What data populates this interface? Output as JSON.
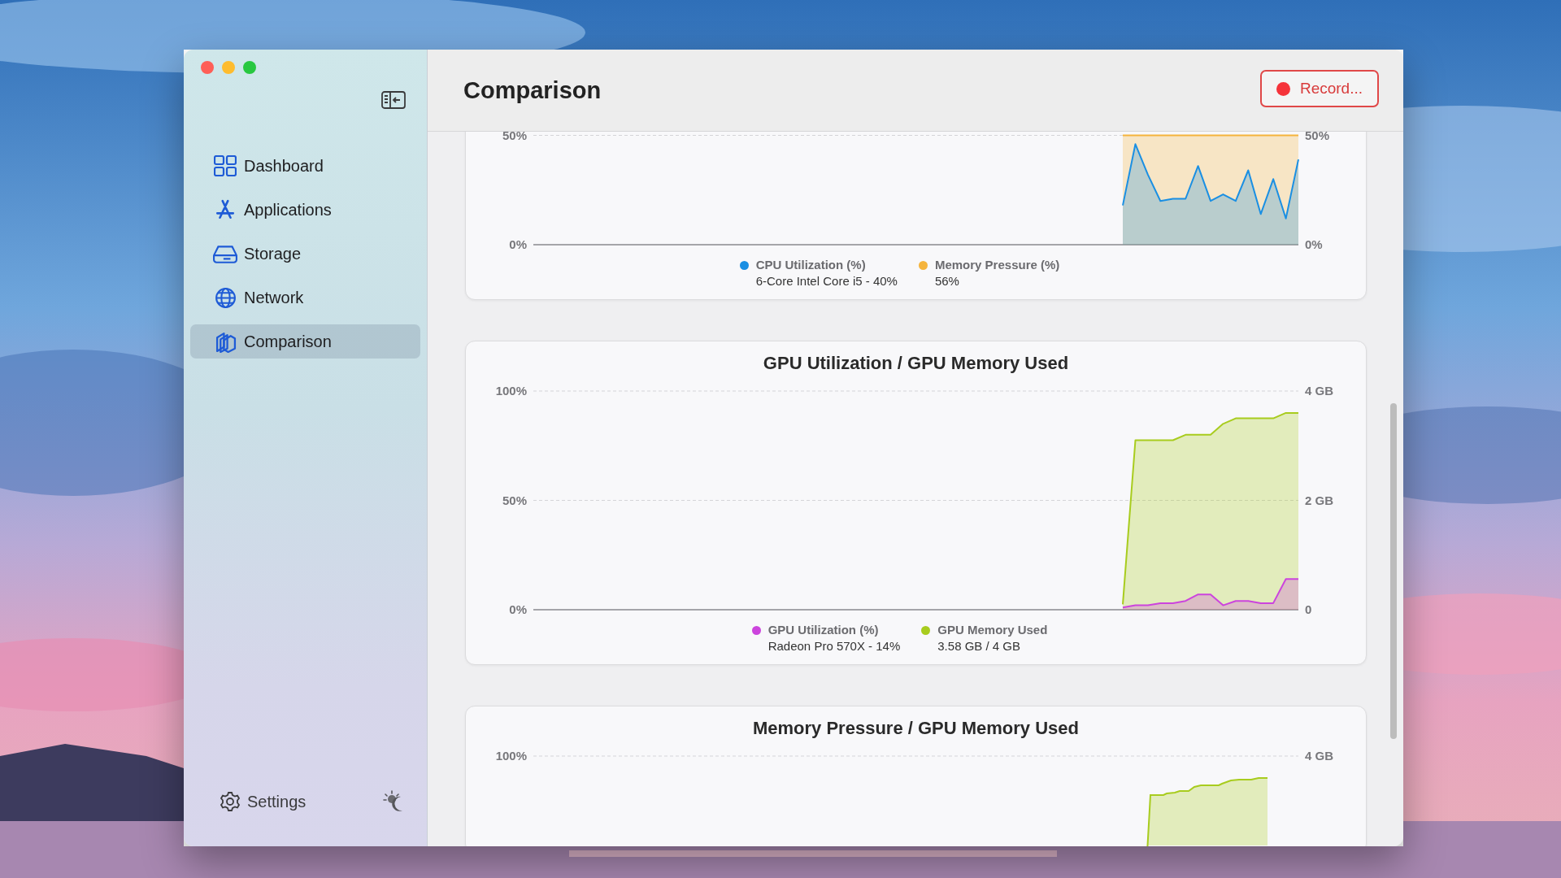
{
  "sidebar": {
    "items": [
      {
        "label": "Dashboard",
        "kind": "grid",
        "selected": false
      },
      {
        "label": "Applications",
        "kind": "apps",
        "selected": false
      },
      {
        "label": "Storage",
        "kind": "drive",
        "selected": false
      },
      {
        "label": "Network",
        "kind": "globe",
        "selected": false
      },
      {
        "label": "Comparison",
        "kind": "compare",
        "selected": true
      }
    ],
    "settings": {
      "label": "Settings"
    }
  },
  "header": {
    "title": "Comparison",
    "record_button": "Record..."
  },
  "charts": [
    {
      "legend_details": [
        "6-Core Intel Core i5 - 40%",
        "56%"
      ],
      "chart_data": {
        "type": "area",
        "categories": [
          null,
          null,
          null,
          null,
          null,
          null,
          null,
          null,
          null,
          null,
          null,
          null,
          null,
          null,
          null,
          null,
          null,
          null,
          null,
          null,
          null,
          null,
          null,
          null,
          null,
          null,
          null,
          null,
          null,
          null,
          null,
          null,
          null,
          null,
          null,
          null,
          null,
          null,
          null,
          null,
          null,
          null,
          null,
          null,
          null,
          null,
          null,
          null,
          null,
          null,
          null,
          null,
          null,
          null,
          null,
          null,
          null,
          null,
          null,
          null,
          null,
          null
        ],
        "ylim": [
          0,
          50
        ],
        "yticks": [
          {
            "value": 0,
            "label": "0%"
          },
          {
            "value": 50,
            "label": "50%"
          }
        ],
        "y2lim": [
          0,
          50
        ],
        "y2ticks": [
          {
            "value": 0,
            "label": "0%"
          },
          {
            "value": 50,
            "label": "50%"
          }
        ],
        "series": [
          {
            "name": "CPU Utilization (%)",
            "color": "#1a8fe3",
            "values": [
              null,
              null,
              null,
              null,
              null,
              null,
              null,
              null,
              null,
              null,
              null,
              null,
              null,
              null,
              null,
              null,
              null,
              null,
              null,
              null,
              null,
              null,
              null,
              null,
              null,
              null,
              null,
              null,
              null,
              null,
              null,
              null,
              null,
              null,
              null,
              null,
              null,
              null,
              null,
              null,
              null,
              null,
              null,
              null,
              null,
              null,
              null,
              18,
              46,
              32,
              20,
              21,
              21,
              36,
              20,
              23,
              20,
              34,
              14,
              30,
              12,
              39
            ]
          },
          {
            "name": "Memory Pressure (%)",
            "color": "#f5b43c",
            "axis": "y2",
            "values": [
              null,
              null,
              null,
              null,
              null,
              null,
              null,
              null,
              null,
              null,
              null,
              null,
              null,
              null,
              null,
              null,
              null,
              null,
              null,
              null,
              null,
              null,
              null,
              null,
              null,
              null,
              null,
              null,
              null,
              null,
              null,
              null,
              null,
              null,
              null,
              null,
              null,
              null,
              null,
              null,
              null,
              null,
              null,
              null,
              null,
              null,
              null,
              50,
              50,
              50,
              50,
              50,
              50,
              50,
              50,
              50,
              50,
              50,
              50,
              50,
              50,
              50
            ]
          }
        ]
      }
    },
    {
      "legend_details": [
        "Radeon Pro 570X - 14%",
        "3.58 GB / 4 GB"
      ],
      "chart_data": {
        "type": "area",
        "title": "GPU Utilization / GPU Memory Used",
        "categories": [
          null,
          null,
          null,
          null,
          null,
          null,
          null,
          null,
          null,
          null,
          null,
          null,
          null,
          null,
          null,
          null,
          null,
          null,
          null,
          null,
          null,
          null,
          null,
          null,
          null,
          null,
          null,
          null,
          null,
          null,
          null,
          null,
          null,
          null,
          null,
          null,
          null,
          null,
          null,
          null,
          null,
          null,
          null,
          null,
          null,
          null,
          null,
          null,
          null,
          null,
          null,
          null,
          null,
          null,
          null,
          null,
          null,
          null,
          null,
          null,
          null,
          null
        ],
        "ylim": [
          0,
          100
        ],
        "yticks": [
          {
            "value": 0,
            "label": "0%"
          },
          {
            "value": 50,
            "label": "50%"
          },
          {
            "value": 100,
            "label": "100%"
          }
        ],
        "y2lim": [
          0,
          4
        ],
        "y2ticks": [
          {
            "value": 0,
            "label": "0"
          },
          {
            "value": 2,
            "label": "2 GB"
          },
          {
            "value": 4,
            "label": "4 GB"
          }
        ],
        "series": [
          {
            "name": "GPU Utilization (%)",
            "color": "#cc44dd",
            "values": [
              null,
              null,
              null,
              null,
              null,
              null,
              null,
              null,
              null,
              null,
              null,
              null,
              null,
              null,
              null,
              null,
              null,
              null,
              null,
              null,
              null,
              null,
              null,
              null,
              null,
              null,
              null,
              null,
              null,
              null,
              null,
              null,
              null,
              null,
              null,
              null,
              null,
              null,
              null,
              null,
              null,
              null,
              null,
              null,
              null,
              null,
              null,
              1,
              2,
              2,
              3,
              3,
              4,
              7,
              7,
              2,
              4,
              4,
              3,
              3,
              14,
              14
            ]
          },
          {
            "name": "GPU Memory Used",
            "color": "#a8cc1e",
            "axis": "y2",
            "values": [
              null,
              null,
              null,
              null,
              null,
              null,
              null,
              null,
              null,
              null,
              null,
              null,
              null,
              null,
              null,
              null,
              null,
              null,
              null,
              null,
              null,
              null,
              null,
              null,
              null,
              null,
              null,
              null,
              null,
              null,
              null,
              null,
              null,
              null,
              null,
              null,
              null,
              null,
              null,
              null,
              null,
              null,
              null,
              null,
              null,
              null,
              null,
              0.1,
              3.1,
              3.1,
              3.1,
              3.1,
              3.2,
              3.2,
              3.2,
              3.4,
              3.5,
              3.5,
              3.5,
              3.5,
              3.6,
              3.6
            ]
          }
        ]
      }
    },
    {
      "title": "Memory Pressure / GPU Memory Used",
      "left_label": "100%",
      "right_label": "4 GB"
    }
  ]
}
